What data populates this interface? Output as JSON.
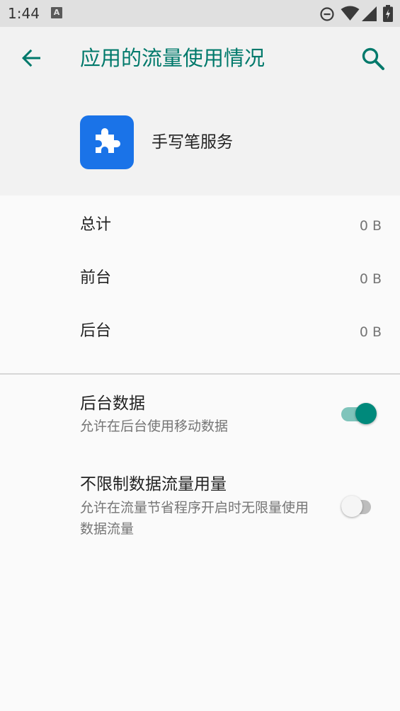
{
  "status_bar": {
    "time": "1:44",
    "notification_icon_letter": "A",
    "icons": [
      "dnd-icon",
      "wifi-icon",
      "signal-icon",
      "battery-icon"
    ]
  },
  "toolbar": {
    "title": "应用的流量使用情况",
    "back_icon": "arrow-back-icon",
    "search_icon": "search-icon"
  },
  "app": {
    "name": "手写笔服务",
    "icon": "puzzle-piece-icon"
  },
  "usage": [
    {
      "label": "总计",
      "value": "0 B"
    },
    {
      "label": "前台",
      "value": "0 B"
    },
    {
      "label": "后台",
      "value": "0 B"
    }
  ],
  "settings": [
    {
      "title": "后台数据",
      "summary": "允许在后台使用移动数据",
      "enabled": true
    },
    {
      "title": "不限制数据流量用量",
      "summary": "允许在流量节省程序开启时无限量使用数据流量",
      "enabled": false
    }
  ],
  "colors": {
    "accent": "#00796b",
    "switch_on_thumb": "#00897b",
    "switch_on_track": "#7fc4bb",
    "app_icon_bg": "#1a73e8",
    "status_bar_bg": "#e0e0e0",
    "header_bg": "#f2f2f2"
  }
}
